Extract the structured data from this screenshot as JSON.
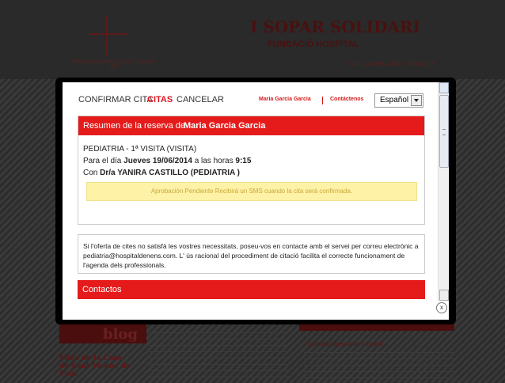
{
  "background": {
    "logo_text": "FUNDACIÓ HOSPITAL SANT JOAN DE DÉU",
    "title": "I SOPAR SOLIDARI",
    "subtitle": "FUNDACIÓ HOSPITAL",
    "nav": "CAT | CASTELLANO | CONTACTE",
    "blog_label": "blog",
    "bottom_title": "Fites de la Casa de Sant Vicenç de Paül",
    "bottom_link": "• Consulta l'agenda de l'Hospital"
  },
  "modal": {
    "nav": {
      "confirm": "CONFIRMAR CITA",
      "citas": "CITAS",
      "cancel": "CANCELAR"
    },
    "user_name": "Maria Garcia Garcia",
    "contact_label": "Contáctenos",
    "language": {
      "selected": "Español"
    },
    "summary": {
      "prefix": "Resumen de la reserva de",
      "name": "Maria Garcia Garcia",
      "service": "PEDIATRIA - 1ª VISITA (VISITA)",
      "when_prefix": "Para el día",
      "date": "Jueves 19/06/2014",
      "when_mid": "a las horas",
      "time": "9:15",
      "doctor_prefix": "Con",
      "doctor": "Dr/a YANIRA CASTILLO (PEDIATRIA )",
      "pending": "Aprobación Pendiente Recibirá un SMS cuando la cita será confirmada."
    },
    "info": "Si l'oferta de cites no satisfà les vostres necessitats, poseu-vos en contacte amb el servei per correu electrònic a pediatria@hospitaldenens.com. L' ús racional del procediment de citació facilita el correcte funcionament de l'agenda dels professionals.",
    "contactos": "Contactos",
    "close": "x"
  }
}
